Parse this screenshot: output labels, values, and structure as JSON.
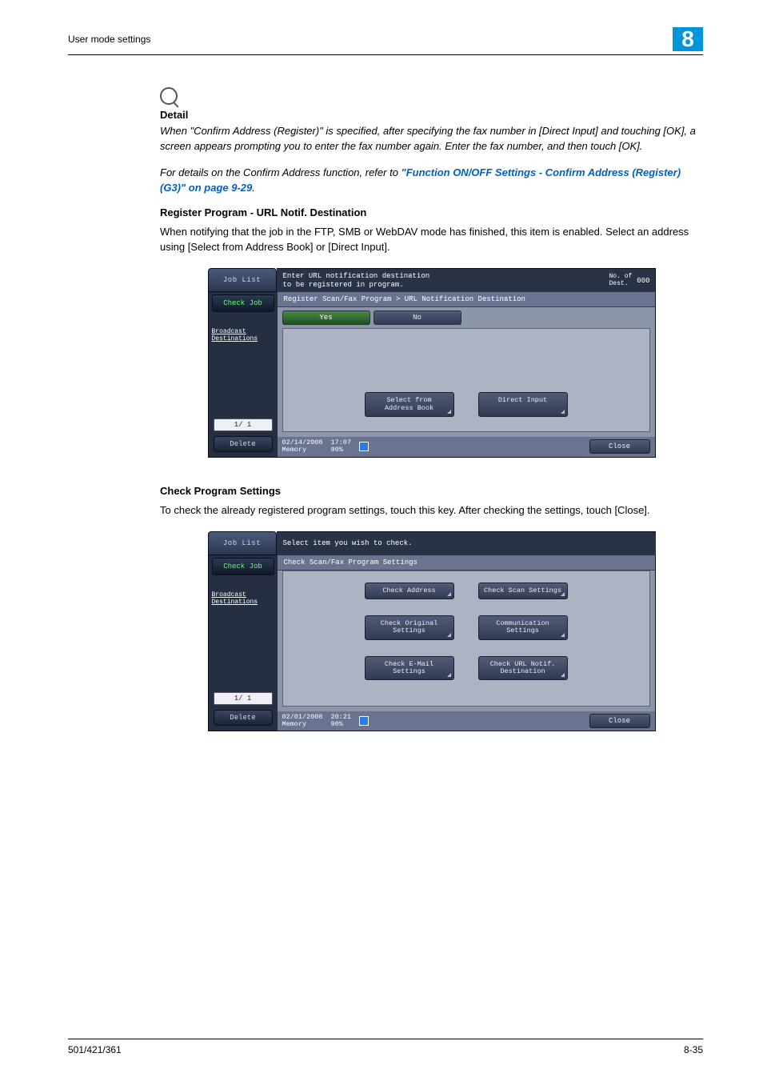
{
  "header": {
    "left": "User mode settings",
    "badge": "8"
  },
  "detail": {
    "label": "Detail",
    "p1": "When \"Confirm Address (Register)\" is specified, after specifying the fax number in [Direct Input] and touching [OK], a screen appears prompting you to enter the fax number again. Enter the fax number, and then touch [OK].",
    "p2a": "For details on the Confirm Address function, refer to ",
    "p2link": "\"Function ON/OFF Settings - Confirm Address (Register) (G3)\" on page 9-29",
    "p2b": "."
  },
  "sec1": {
    "heading": "Register Program - URL Notif. Destination",
    "body": "When notifying that the job in the FTP, SMB or WebDAV mode has finished, this item is enabled. Select an address using [Select from Address Book] or [Direct Input]."
  },
  "panel1": {
    "joblist": "Job List",
    "message": "Enter URL notification destination\nto be registered in program.",
    "dest_label": "No. of\nDest.",
    "dest_count": "000",
    "check_job": "Check Job",
    "broadcast": "Broadcast\nDestinations",
    "pager": "1/  1",
    "delete": "Delete",
    "breadcrumb": "Register Scan/Fax Program > URL Notification Destination",
    "yes": "Yes",
    "no": "No",
    "select_from": "Select from\nAddress Book",
    "direct_input": "Direct Input",
    "date": "02/14/2008",
    "time": "17:07",
    "memory": "Memory",
    "memval": "90%",
    "close": "Close"
  },
  "sec2": {
    "heading": "Check Program Settings",
    "body": "To check the already registered program settings, touch this key. After checking the settings, touch [Close]."
  },
  "panel2": {
    "joblist": "Job List",
    "message": "Select item you wish to check.",
    "check_job": "Check Job",
    "broadcast": "Broadcast\nDestinations",
    "pager": "1/  1",
    "delete": "Delete",
    "breadcrumb": "Check Scan/Fax Program Settings",
    "btns": {
      "check_address": "Check Address",
      "check_scan": "Check Scan Settings",
      "check_original": "Check Original\nSettings",
      "communication": "Communication\nSettings",
      "check_email": "Check E-Mail\nSettings",
      "check_url": "Check URL Notif.\nDestination"
    },
    "date": "02/01/2008",
    "time": "20:21",
    "memory": "Memory",
    "memval": "90%",
    "close": "Close"
  },
  "footer": {
    "left": "501/421/361",
    "right": "8-35"
  }
}
